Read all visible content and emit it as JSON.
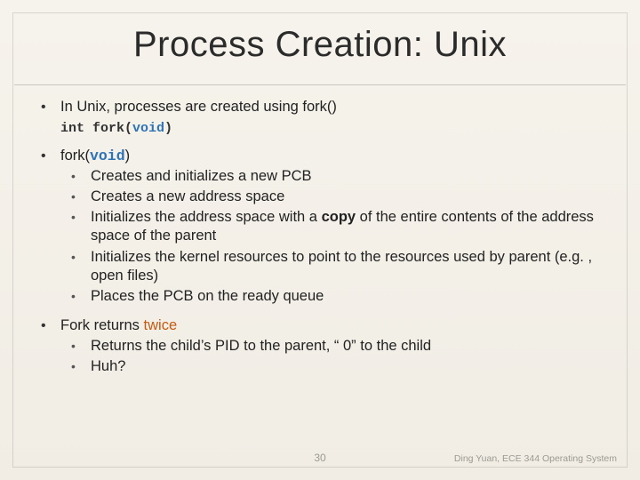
{
  "title": "Process Creation: Unix",
  "bullet1": {
    "text": "In Unix, processes are created using fork()",
    "code_html": "<span>int fork(</span><span class='kw'>void</span><span>)</span>"
  },
  "bullet2": {
    "prefix": "fork(",
    "void": "void",
    "suffix": ")",
    "sub": [
      "Creates and initializes a new PCB",
      "Creates a new address space"
    ],
    "sub_copy_pre": "Initializes the address space with a ",
    "sub_copy_bold": "copy",
    "sub_copy_post": " of the entire contents of the address space of the parent",
    "sub_after": [
      "Initializes the kernel resources to point to the resources used by parent (e.g. , open files)",
      "Places the PCB on the ready queue"
    ]
  },
  "bullet3": {
    "prefix": "Fork returns ",
    "twice": "twice",
    "sub": [
      "Returns the child’s PID to the parent, “ 0” to the child",
      "Huh?"
    ]
  },
  "footer": {
    "page": "30",
    "credit": "Ding Yuan, ECE 344 Operating System"
  }
}
